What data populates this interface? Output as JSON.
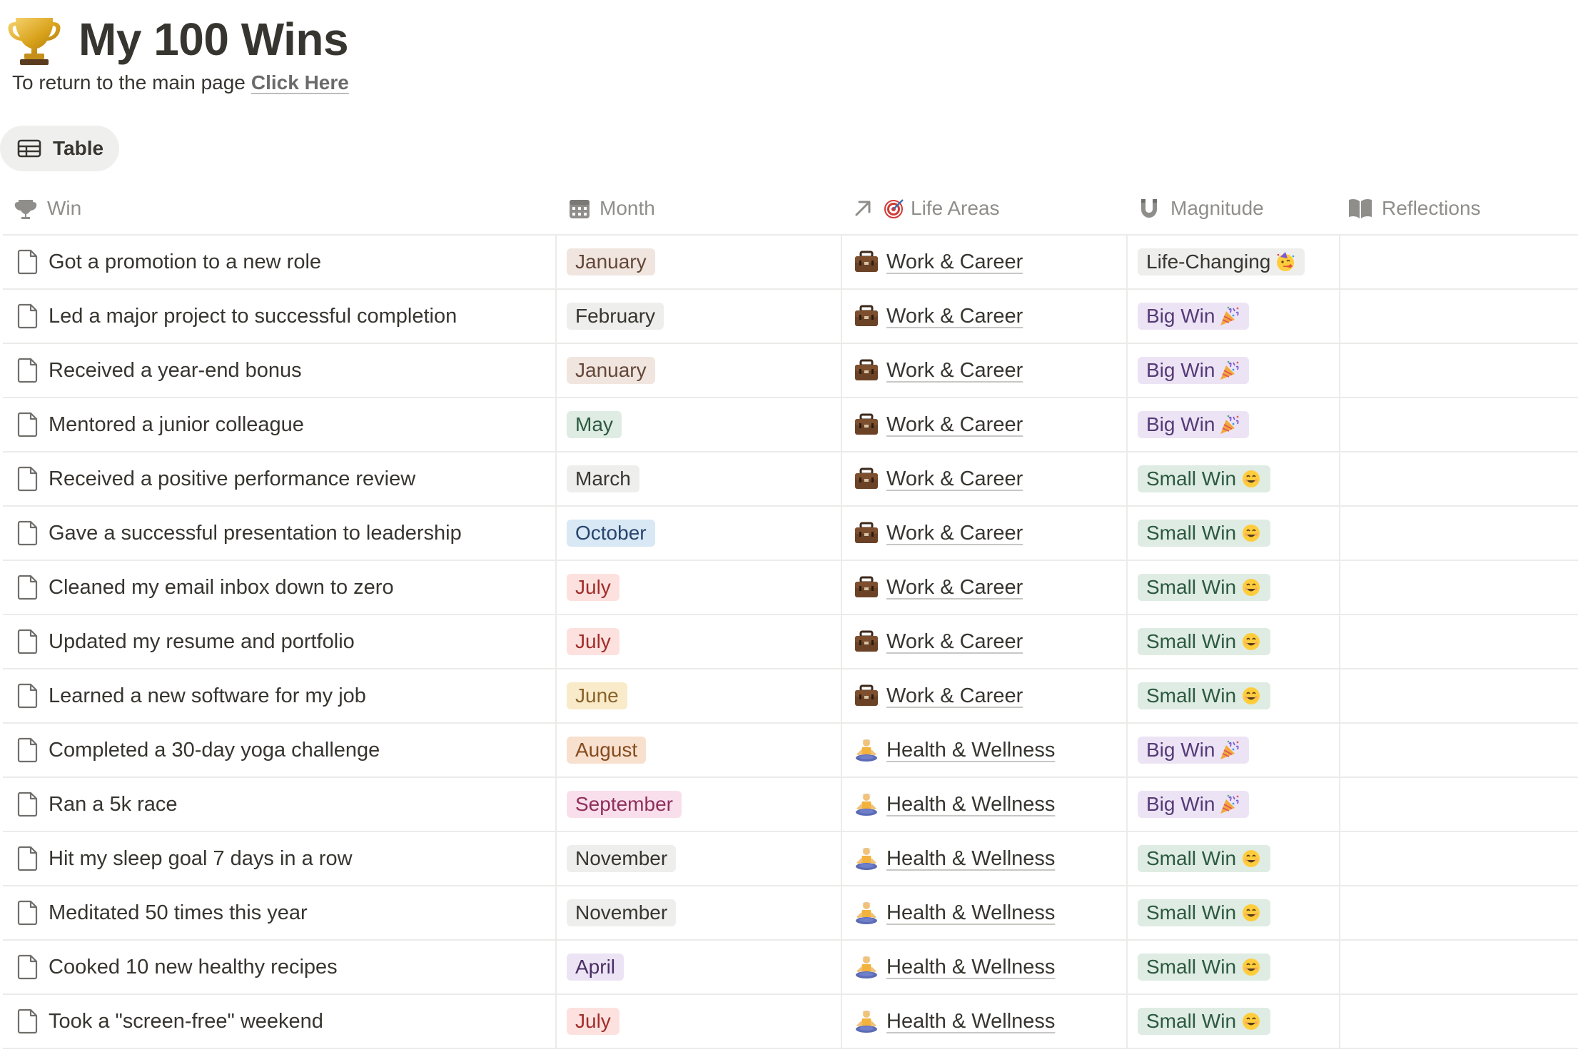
{
  "page": {
    "title": "My 100 Wins",
    "subtitle": "To return to the main page",
    "link_label": "Click Here"
  },
  "view": {
    "tab_label": "Table"
  },
  "columns": {
    "win": "Win",
    "month": "Month",
    "life_areas": "Life Areas",
    "magnitude": "Magnitude",
    "reflections": "Reflections"
  },
  "colors": {
    "month_brown_bg": "#f0e6df",
    "month_brown_fg": "#64473a",
    "month_gray_bg": "#eeeeed",
    "month_gray_fg": "#37352f",
    "month_green_bg": "#dfece3",
    "month_green_fg": "#2b593f",
    "month_blue_bg": "#d8e8f5",
    "month_blue_fg": "#28456c",
    "month_red_bg": "#fde1df",
    "month_red_fg": "#9f2d2a",
    "month_yellow_bg": "#f9ebc9",
    "month_yellow_fg": "#89632a",
    "month_orange_bg": "#f8e0cf",
    "month_orange_fg": "#854c1d",
    "month_pink_bg": "#f9dfeb",
    "month_pink_fg": "#8e2f5c",
    "month_purple_bg": "#ece4f4",
    "month_purple_fg": "#492f64"
  },
  "rows": [
    {
      "win": "Got a promotion to a new role",
      "month": "January",
      "month_color": "brown",
      "area": "Work & Career",
      "area_icon": "briefcase-icon",
      "magnitude": "Life-Changing",
      "mag_icon": "partying-face-icon"
    },
    {
      "win": "Led a major project to successful completion",
      "month": "February",
      "month_color": "gray",
      "area": "Work & Career",
      "area_icon": "briefcase-icon",
      "magnitude": "Big Win",
      "mag_icon": "party-popper-icon"
    },
    {
      "win": "Received a year-end bonus",
      "month": "January",
      "month_color": "brown",
      "area": "Work & Career",
      "area_icon": "briefcase-icon",
      "magnitude": "Big Win",
      "mag_icon": "party-popper-icon"
    },
    {
      "win": "Mentored a junior colleague",
      "month": "May",
      "month_color": "green",
      "area": "Work & Career",
      "area_icon": "briefcase-icon",
      "magnitude": "Big Win",
      "mag_icon": "party-popper-icon"
    },
    {
      "win": "Received a positive performance review",
      "month": "March",
      "month_color": "gray",
      "area": "Work & Career",
      "area_icon": "briefcase-icon",
      "magnitude": "Small Win",
      "mag_icon": "smiling-face-icon"
    },
    {
      "win": "Gave a successful presentation to leadership",
      "month": "October",
      "month_color": "blue",
      "area": "Work & Career",
      "area_icon": "briefcase-icon",
      "magnitude": "Small Win",
      "mag_icon": "smiling-face-icon"
    },
    {
      "win": "Cleaned my email inbox down to zero",
      "month": "July",
      "month_color": "red",
      "area": "Work & Career",
      "area_icon": "briefcase-icon",
      "magnitude": "Small Win",
      "mag_icon": "smiling-face-icon"
    },
    {
      "win": "Updated my resume and portfolio",
      "month": "July",
      "month_color": "red",
      "area": "Work & Career",
      "area_icon": "briefcase-icon",
      "magnitude": "Small Win",
      "mag_icon": "smiling-face-icon"
    },
    {
      "win": "Learned a new software for my job",
      "month": "June",
      "month_color": "yellow",
      "area": "Work & Career",
      "area_icon": "briefcase-icon",
      "magnitude": "Small Win",
      "mag_icon": "smiling-face-icon"
    },
    {
      "win": "Completed a 30-day yoga challenge",
      "month": "August",
      "month_color": "orange",
      "area": "Health & Wellness",
      "area_icon": "meditating-person-icon",
      "magnitude": "Big Win",
      "mag_icon": "party-popper-icon"
    },
    {
      "win": "Ran a 5k race",
      "month": "September",
      "month_color": "pink",
      "area": "Health & Wellness",
      "area_icon": "meditating-person-icon",
      "magnitude": "Big Win",
      "mag_icon": "party-popper-icon"
    },
    {
      "win": "Hit my sleep goal 7 days in a row",
      "month": "November",
      "month_color": "gray",
      "area": "Health & Wellness",
      "area_icon": "meditating-person-icon",
      "magnitude": "Small Win",
      "mag_icon": "smiling-face-icon"
    },
    {
      "win": "Meditated 50 times this year",
      "month": "November",
      "month_color": "gray",
      "area": "Health & Wellness",
      "area_icon": "meditating-person-icon",
      "magnitude": "Small Win",
      "mag_icon": "smiling-face-icon"
    },
    {
      "win": "Cooked 10 new healthy recipes",
      "month": "April",
      "month_color": "purple",
      "area": "Health & Wellness",
      "area_icon": "meditating-person-icon",
      "magnitude": "Small Win",
      "mag_icon": "smiling-face-icon"
    },
    {
      "win": "Took a \"screen-free\" weekend",
      "month": "July",
      "month_color": "red",
      "area": "Health & Wellness",
      "area_icon": "meditating-person-icon",
      "magnitude": "Small Win",
      "mag_icon": "smiling-face-icon"
    }
  ],
  "magnitude_styles": {
    "Life-Changing": {
      "bg": "#eeeeed",
      "fg": "#37352f"
    },
    "Big Win": {
      "bg": "#ece4f4",
      "fg": "#553a78"
    },
    "Small Win": {
      "bg": "#dfece3",
      "fg": "#2b593f"
    }
  }
}
